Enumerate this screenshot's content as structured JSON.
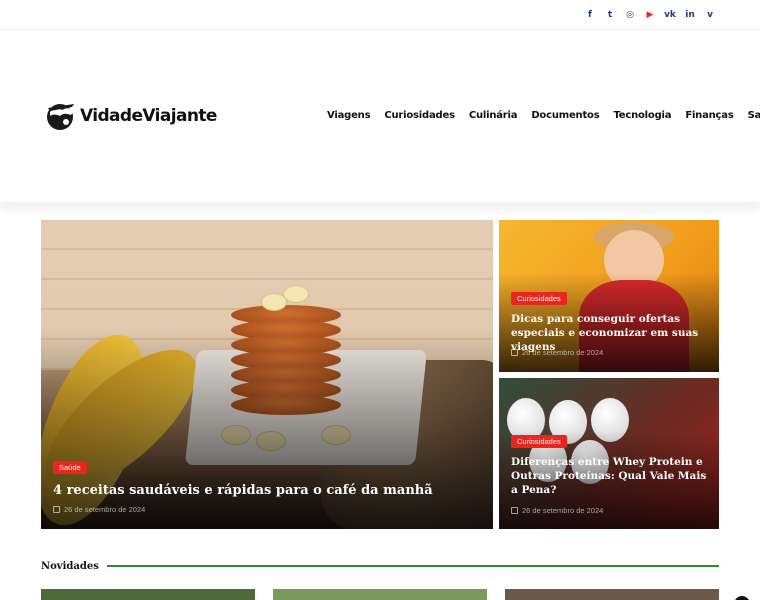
{
  "social": [
    {
      "icon": "facebook-icon",
      "glyph": "f"
    },
    {
      "icon": "twitter-icon",
      "glyph": "t"
    },
    {
      "icon": "instagram-icon",
      "glyph": "◎"
    },
    {
      "icon": "youtube-icon",
      "glyph": "▶"
    },
    {
      "icon": "vk-icon",
      "glyph": "vk"
    },
    {
      "icon": "linkedin-icon",
      "glyph": "in"
    },
    {
      "icon": "vimeo-icon",
      "glyph": "v"
    }
  ],
  "brand": {
    "name": "VidadeViajante"
  },
  "nav": [
    "Viagens",
    "Curiosidades",
    "Culinária",
    "Documentos",
    "Tecnologia",
    "Finanças",
    "Saúde"
  ],
  "featured": {
    "category": "Saúde",
    "title": "4 receitas saudáveis e rápidas para o café da manhã",
    "date": "26 de setembro de 2024"
  },
  "side": [
    {
      "category": "Curiosidades",
      "title": "Dicas para conseguir ofertas especiais e economizar em suas viagens",
      "date": "26 de setembro de 2024"
    },
    {
      "category": "Curiosidades",
      "title": "Diferenças entre Whey Protein e Outras Proteínas: Qual Vale Mais a Pena?",
      "date": "26 de setembro de 2024"
    }
  ],
  "section": {
    "title": "Novidades"
  },
  "colors": {
    "accent_red": "#e8261d",
    "accent_green": "#2e8b2e",
    "social_blue": "#1b3a8c"
  }
}
